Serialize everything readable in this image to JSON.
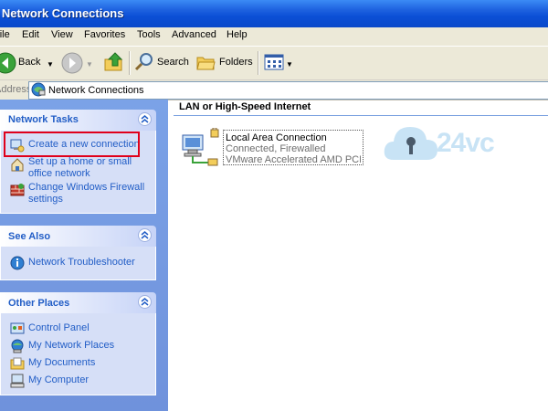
{
  "window": {
    "title": "Network Connections"
  },
  "menu": [
    "File",
    "Edit",
    "View",
    "Favorites",
    "Tools",
    "Advanced",
    "Help"
  ],
  "toolbar": {
    "back": "Back",
    "search": "Search",
    "folders": "Folders"
  },
  "address": {
    "label": "Address",
    "value": "Network Connections"
  },
  "sidebar": {
    "network_tasks": {
      "title": "Network Tasks",
      "items": [
        "Create a new connection",
        "Set up a home or small office network",
        "Change Windows Firewall settings"
      ]
    },
    "see_also": {
      "title": "See Also",
      "items": [
        "Network Troubleshooter"
      ]
    },
    "other_places": {
      "title": "Other Places",
      "items": [
        "Control Panel",
        "My Network Places",
        "My Documents",
        "My Computer"
      ]
    }
  },
  "content": {
    "group_header": "LAN or High-Speed Internet",
    "connection": {
      "name": "Local Area Connection",
      "status": "Connected, Firewalled",
      "device": "VMware Accelerated AMD PCN..."
    }
  },
  "watermark": {
    "text": "24vc"
  },
  "colors": {
    "titlebar": "#0b4fd6",
    "link": "#215dc6",
    "highlight": "#e0001b",
    "sidebar": "#6f92dc"
  }
}
